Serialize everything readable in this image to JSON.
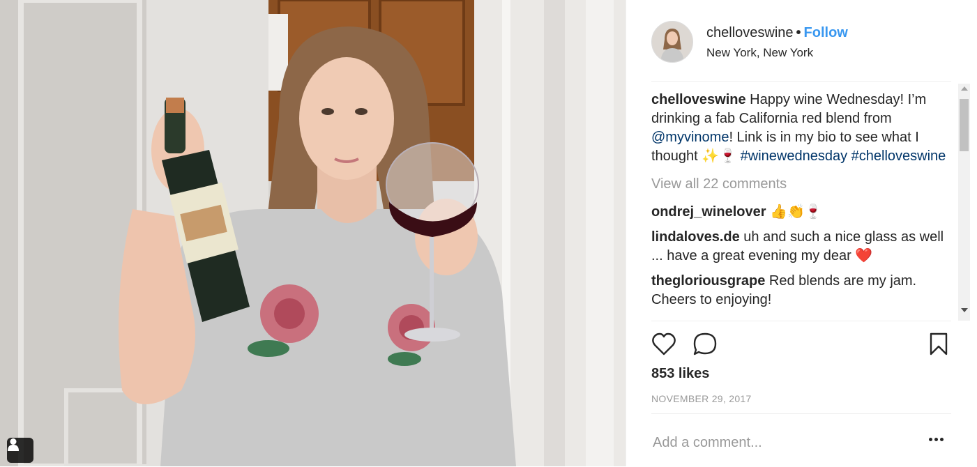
{
  "post": {
    "username": "chelloveswine",
    "follow_label": "Follow",
    "separator": "•",
    "location": "New York, New York"
  },
  "caption": {
    "username": "chelloveswine",
    "text_1": " Happy wine Wednesday! I’m drinking a fab California red blend from ",
    "mention": "@myvinome",
    "text_2": "! Link is in my bio to see what I thought ✨🍷 ",
    "hashtag_1": "#winewednesday",
    "hashtag_2": "#chelloveswine"
  },
  "view_all_comments": "View all 22 comments",
  "comments": [
    {
      "user": "ondrej_winelover",
      "text": " 👍👏🍷"
    },
    {
      "user": "lindaloves.de",
      "text": " uh and such a nice glass as well ... have a great evening my dear ❤️"
    },
    {
      "user": "thegloriousgrape",
      "text": " Red blends are my jam. Cheers to enjoying!"
    }
  ],
  "likes": "853 likes",
  "date": "NOVEMBER 29, 2017",
  "add_comment_placeholder": "Add a comment...",
  "icons": {
    "like": "heart-icon",
    "comment": "comment-icon",
    "save": "bookmark-icon",
    "more": "more-icon",
    "tag": "user-tag-icon"
  },
  "colors": {
    "link": "#3897f0",
    "hashtag": "#003569",
    "muted": "#999999"
  }
}
